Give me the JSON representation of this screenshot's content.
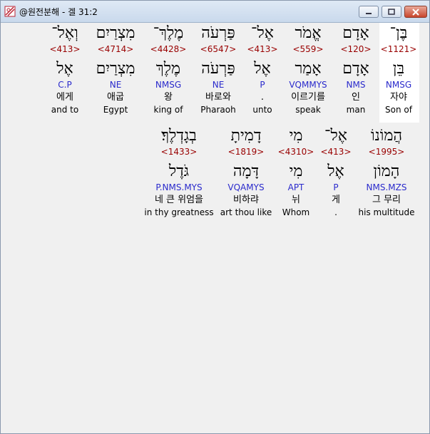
{
  "window": {
    "title": "@원전분해 - 겔 31:2",
    "icon": "app-logo-icon",
    "controls": [
      "minimize-icon",
      "maximize-icon",
      "close-icon"
    ]
  },
  "line1": [
    {
      "heb": "בֶּן־",
      "strong": "<1121>",
      "heb2": "בֵּן",
      "parse": "NMSG",
      "kor": "자야",
      "eng": "Son of"
    },
    {
      "heb": "אָדָם",
      "strong": "<120>",
      "heb2": "אָדָם",
      "parse": "NMS",
      "kor": "인",
      "eng": "man"
    },
    {
      "heb": "אֱמֹר",
      "strong": "<559>",
      "heb2": "אָמַר",
      "parse": "VQMMYS",
      "kor": "이르기를",
      "eng": "speak"
    },
    {
      "heb": "אֶל־",
      "strong": "<413>",
      "heb2": "אֶל",
      "parse": "P",
      "kor": ".",
      "eng": "unto"
    },
    {
      "heb": "פַּרְעֹה",
      "strong": "<6547>",
      "heb2": "פַּרְעֹה",
      "parse": "NE",
      "kor": "바로와",
      "eng": "Pharaoh"
    },
    {
      "heb": "מֶלֶךְ־",
      "strong": "<4428>",
      "heb2": "מֶלֶךְ",
      "parse": "NMSG",
      "kor": "왕",
      "eng": "king of"
    },
    {
      "heb": "מִצְרַיִם",
      "strong": "<4714>",
      "heb2": "מִצְרַיִם",
      "parse": "NE",
      "kor": "애굽",
      "eng": "Egypt"
    },
    {
      "heb": "וְאֶל־",
      "strong": "<413>",
      "heb2": "אֶל",
      "parse": "C.P",
      "kor": "에게",
      "eng": "and to"
    }
  ],
  "line2": [
    {
      "heb": "הֲמוֹנוֹ",
      "strong": "<1995>",
      "heb2": "הָמוֹן",
      "parse": "NMS.MZS",
      "kor": "그 무리",
      "eng": "his multitude"
    },
    {
      "heb": "אֶל־",
      "strong": "<413>",
      "heb2": "אֶל",
      "parse": "P",
      "kor": "게",
      "eng": "."
    },
    {
      "heb": "מִי",
      "strong": "<4310>",
      "heb2": "מִי",
      "parse": "APT",
      "kor": "뉘",
      "eng": "Whom"
    },
    {
      "heb": "דָמִיתָ",
      "strong": "<1819>",
      "heb2": "דָּמָה",
      "parse": "VQAMYS",
      "kor": "비하랴",
      "eng": "art thou like"
    },
    {
      "heb": "בְגָדְלֶךָ׃",
      "strong": "<1433>",
      "heb2": "גֹּדֶל",
      "parse": "P.NMS.MYS",
      "kor": "네 큰 위엄을",
      "eng": "in thy greatness"
    }
  ]
}
